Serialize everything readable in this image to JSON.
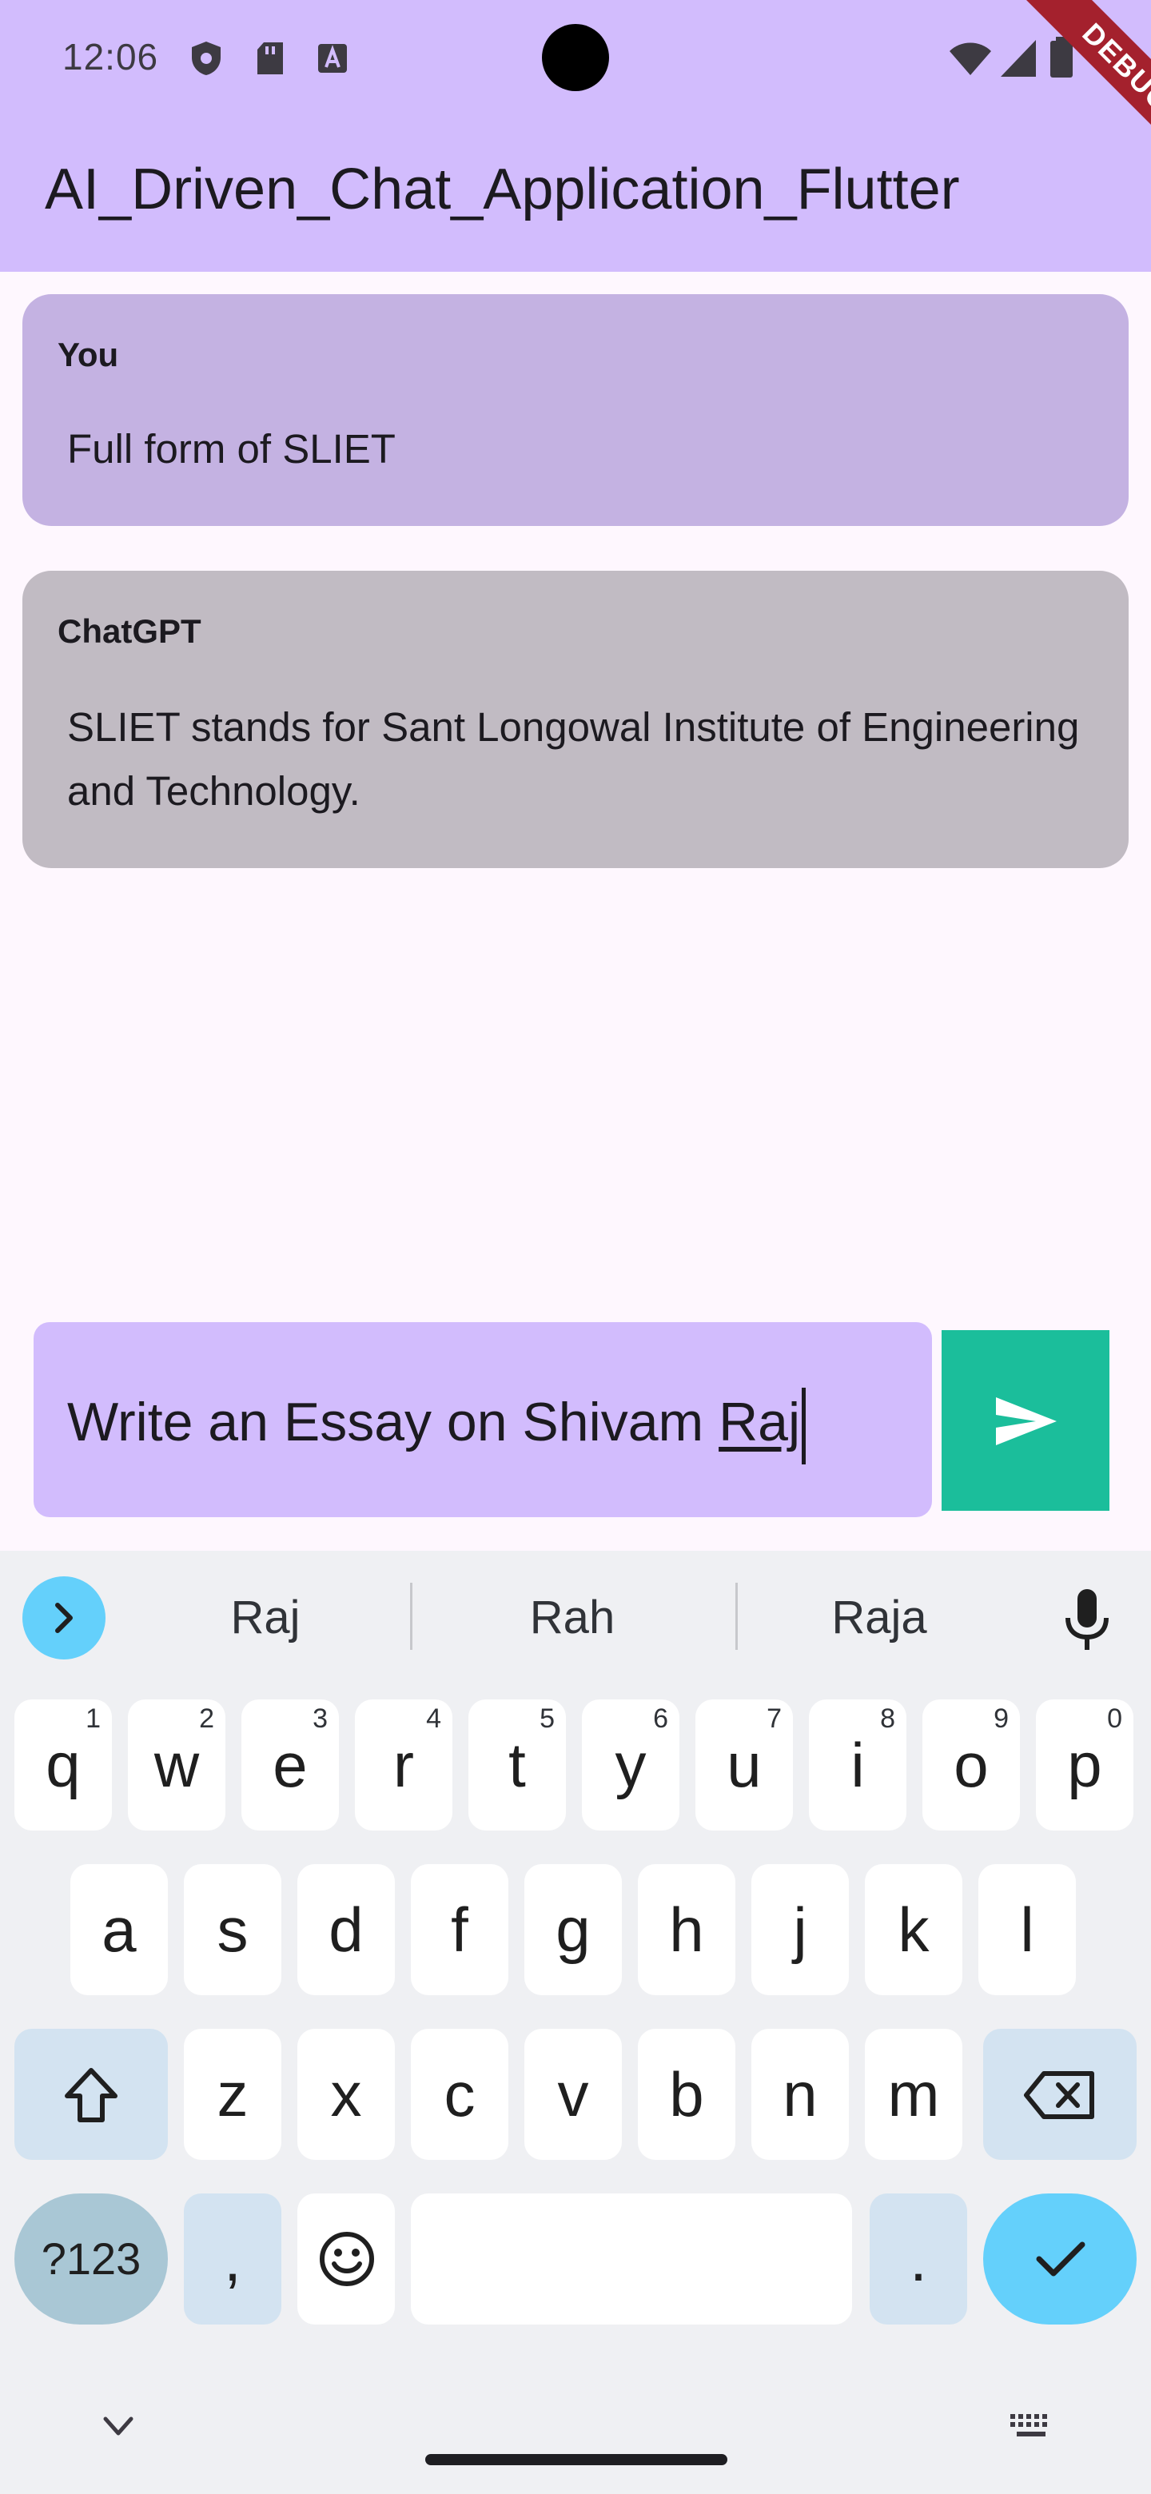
{
  "status_bar": {
    "time": "12:06"
  },
  "app_bar": {
    "title": "AI_Driven_Chat_Application_Flutter",
    "debug_label": "DEBUG"
  },
  "messages": [
    {
      "sender": "You",
      "text": "Full form of SLIET"
    },
    {
      "sender": "ChatGPT",
      "text": "SLIET stands for Sant Longowal Institute of Engineering and Technology."
    }
  ],
  "composer": {
    "text_prefix": "Write an Essay on Shivam ",
    "text_composing": "Raj"
  },
  "keyboard": {
    "suggestions": [
      "Raj",
      "Rah",
      "Raja"
    ],
    "row1": [
      {
        "k": "q",
        "n": "1"
      },
      {
        "k": "w",
        "n": "2"
      },
      {
        "k": "e",
        "n": "3"
      },
      {
        "k": "r",
        "n": "4"
      },
      {
        "k": "t",
        "n": "5"
      },
      {
        "k": "y",
        "n": "6"
      },
      {
        "k": "u",
        "n": "7"
      },
      {
        "k": "i",
        "n": "8"
      },
      {
        "k": "o",
        "n": "9"
      },
      {
        "k": "p",
        "n": "0"
      }
    ],
    "row2": [
      "a",
      "s",
      "d",
      "f",
      "g",
      "h",
      "j",
      "k",
      "l"
    ],
    "row3": [
      "z",
      "x",
      "c",
      "v",
      "b",
      "n",
      "m"
    ],
    "sym_label": "?123",
    "comma": ",",
    "period": "."
  },
  "colors": {
    "app_bar": "#d2bcfd",
    "user_bubble": "#c4b2e2",
    "bot_bubble": "#c1bbc3",
    "send_button": "#1bbe9b",
    "debug_ribbon": "#a4212d"
  }
}
